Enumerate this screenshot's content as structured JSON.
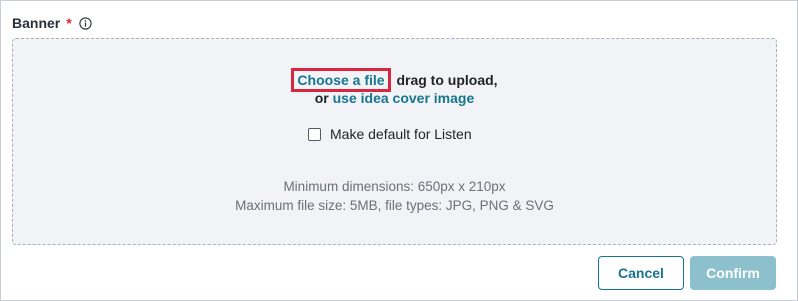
{
  "field": {
    "label": "Banner",
    "required_mark": "*"
  },
  "upload": {
    "choose_link": "Choose a file",
    "drag_text": "drag to upload,",
    "or_text": "or",
    "cover_link": "use idea cover image",
    "checkbox_label": "Make default for Listen",
    "checkbox_checked": false,
    "min_dimensions": "Minimum dimensions: 650px x 210px",
    "max_size": "Maximum file size: 5MB, file types: JPG, PNG & SVG"
  },
  "actions": {
    "cancel_label": "Cancel",
    "confirm_label": "Confirm"
  },
  "colors": {
    "accent": "#17758f",
    "required": "#d9262c",
    "highlight": "#d7263d",
    "confirm_disabled": "#8cc0cc"
  },
  "icons": {
    "info": "info-icon"
  }
}
